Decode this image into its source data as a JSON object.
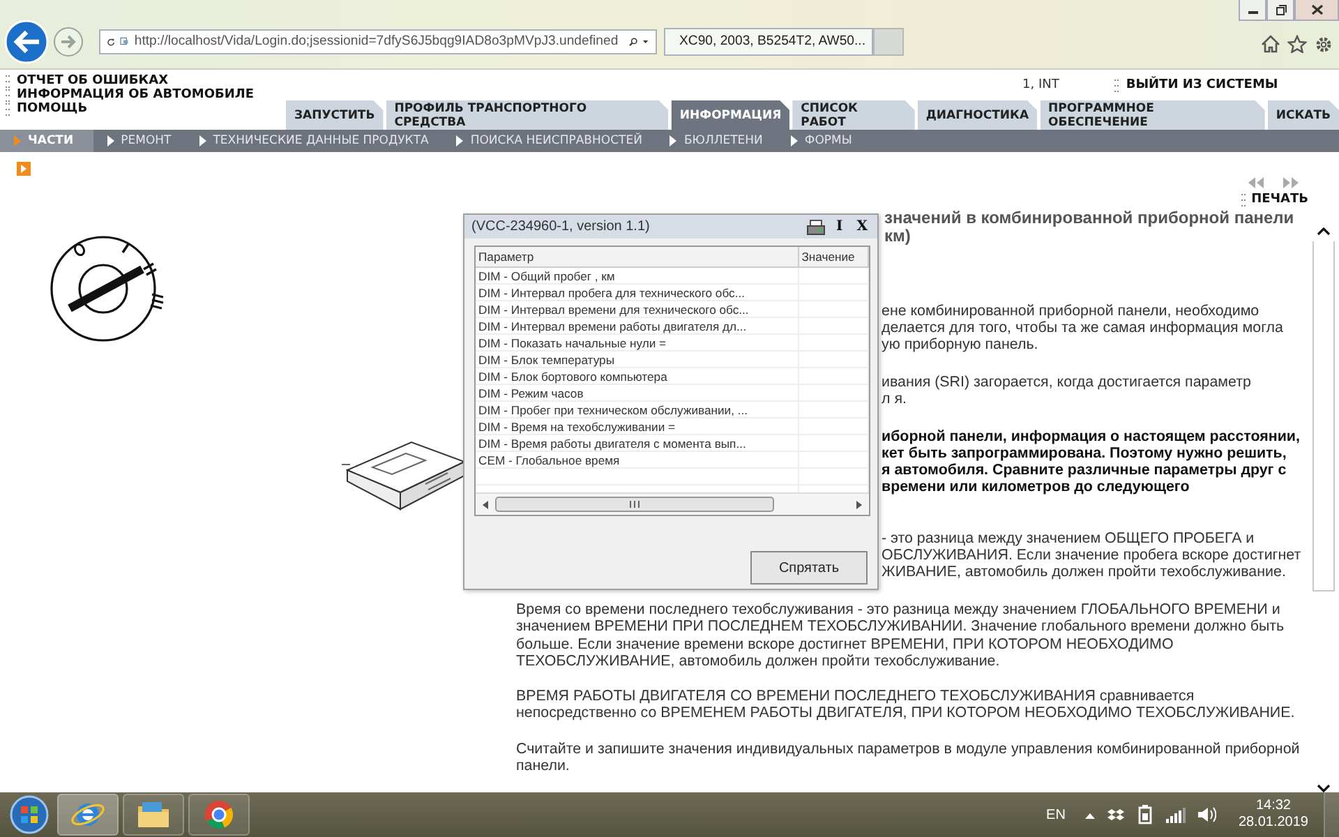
{
  "browser": {
    "url": "http://localhost/Vida/Login.do;jsessionid=7dfyS6J5bqg9IAD8o3pMVpJ3.undefined",
    "tab_title": "XC90, 2003, B5254T2, AW50..."
  },
  "header": {
    "links": [
      "ОТЧЕТ ОБ ОШИБКАХ",
      "ИНФОРМАЦИЯ ОБ АВТОМОБИЛЕ",
      "ПОМОЩЬ"
    ],
    "user": "1, INT",
    "logout": "ВЫЙТИ ИЗ СИСТЕМЫ"
  },
  "tabs": [
    {
      "label": "ЗАПУСТИТЬ",
      "selected": false
    },
    {
      "label": "ПРОФИЛЬ ТРАНСПОРТНОГО СРЕДСТВА",
      "selected": false
    },
    {
      "label": "ИНФОРМАЦИЯ",
      "selected": true
    },
    {
      "label": "СПИСОК РАБОТ",
      "selected": false
    },
    {
      "label": "ДИАГНОСТИКА",
      "selected": false
    },
    {
      "label": "ПРОГРАММНОЕ ОБЕСПЕЧЕНИЕ",
      "selected": false
    },
    {
      "label": "ИСКАТЬ",
      "selected": false
    }
  ],
  "subtabs": [
    {
      "label": "ЧАСТИ",
      "selected": true
    },
    {
      "label": "РЕМОНТ",
      "selected": false
    },
    {
      "label": "ТЕХНИЧЕСКИЕ ДАННЫЕ ПРОДУКТА",
      "selected": false
    },
    {
      "label": "ПОИСКА НЕИСПРАВНОСТЕЙ",
      "selected": false
    },
    {
      "label": "БЮЛЛЕТЕНИ",
      "selected": false
    },
    {
      "label": "ФОРМЫ",
      "selected": false
    }
  ],
  "toolbar": {
    "print": "ПЕЧАТЬ"
  },
  "document": {
    "title_lines": [
      "значений в комбинированной приборной панели",
      "км)"
    ],
    "fragments": [
      {
        "bold": false,
        "lines": [
          "ене комбинированной приборной панели, необходимо",
          "делается для того, чтобы та же самая информация могла",
          "ую приборную панель."
        ]
      },
      {
        "bold": false,
        "lines": [
          "ивания (SRI) загорается, когда достигается параметр",
          "л я."
        ]
      },
      {
        "bold": true,
        "lines": [
          "иборной панели, информация о настоящем расстоянии,",
          "кет быть запрограммирована. Поэтому нужно решить,",
          "я автомобиля. Сравните различные параметры друг с",
          "времени или километров до следующего"
        ]
      },
      {
        "bold": false,
        "lines": [
          "- это разница между значением ОБЩЕГО ПРОБЕГА и",
          "ОБСЛУЖИВАНИЯ. Если значение пробега вскоре достигнет",
          "ЖИВАНИЕ, автомобиль должен пройти техобслуживание."
        ]
      }
    ],
    "paragraphs": [
      "Время со времени последнего техобслуживания - это разница между значением ГЛОБАЛЬНОГО ВРЕМЕНИ и значением ВРЕМЕНИ ПРИ ПОСЛЕДНЕМ ТЕХОБСЛУЖИВАНИИ. Значение глобального времени должно быть больше. Если значение времени вскоре достигнет ВРЕМЕНИ, ПРИ КОТОРОМ НЕОБХОДИМО ТЕХОБСЛУЖИВАНИЕ, автомобиль должен пройти техобслуживание.",
      "ВРЕМЯ РАБОТЫ ДВИГАТЕЛЯ СО ВРЕМЕНИ ПОСЛЕДНЕГО ТЕХОБСЛУЖИВАНИЯ сравнивается непосредственно со ВРЕМЕНЕМ РАБОТЫ ДВИГАТЕЛЯ, ПРИ КОТОРОМ НЕОБХОДИМО ТЕХОБСЛУЖИВАНИЕ.",
      "Считайте и запишите значения индивидуальных параметров в модуле управления комбинированной приборной панели."
    ]
  },
  "dialog": {
    "title": "(VCC-234960-1, version 1.1)",
    "title_buttons": [
      "I",
      "X"
    ],
    "columns": [
      "Параметр",
      "Значение"
    ],
    "rows": [
      "DIM - Общий пробег , км",
      "DIM - Интервал пробега для технического обс...",
      "DIM - Интервал времени для технического обс...",
      "DIM - Интервал времени работы двигателя дл...",
      "DIM - Показать начальные нули =",
      "DIM - Блок температуры",
      "DIM - Блок бортового компьютера",
      "DIM - Режим часов",
      "DIM - Пробег при техническом обслуживании, ...",
      "DIM - Время на техобслуживании =",
      "DIM - Время работы двигателя с момента вып...",
      "CEM - Глобальное время"
    ],
    "button": "Спрятать"
  },
  "taskbar": {
    "language": "EN",
    "time": "14:32",
    "date": "28.01.2019"
  }
}
